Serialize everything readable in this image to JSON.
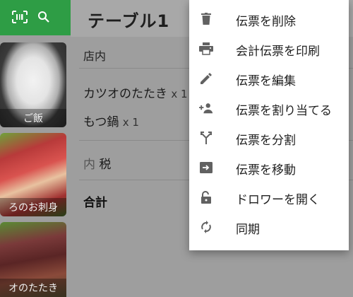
{
  "toolbar": {
    "barcode_icon": "barcode-scan-icon",
    "search_icon": "search-icon",
    "color": "#2e9d45"
  },
  "ticket": {
    "title": "テーブル1",
    "section": "店内",
    "items": [
      {
        "name": "カツオのたたき",
        "qty": "x 1"
      },
      {
        "name": "もつ鍋",
        "qty": "x 1"
      }
    ],
    "tax_prefix": "内",
    "tax_label": "税",
    "total_label": "合計"
  },
  "menu_thumbs": [
    {
      "label": "ご飯"
    },
    {
      "label": "ろのお刺身"
    },
    {
      "label": "オのたたき"
    }
  ],
  "menu": {
    "items": [
      {
        "label": "伝票を削除",
        "icon": "delete-icon"
      },
      {
        "label": "会計伝票を印刷",
        "icon": "print-icon"
      },
      {
        "label": "伝票を編集",
        "icon": "edit-pencil-icon"
      },
      {
        "label": "伝票を割り当てる",
        "icon": "assign-person-icon"
      },
      {
        "label": "伝票を分割",
        "icon": "split-icon"
      },
      {
        "label": "伝票を移動",
        "icon": "move-icon"
      },
      {
        "label": "ドロワーを開く",
        "icon": "unlock-icon"
      },
      {
        "label": "同期",
        "icon": "sync-icon"
      }
    ]
  }
}
